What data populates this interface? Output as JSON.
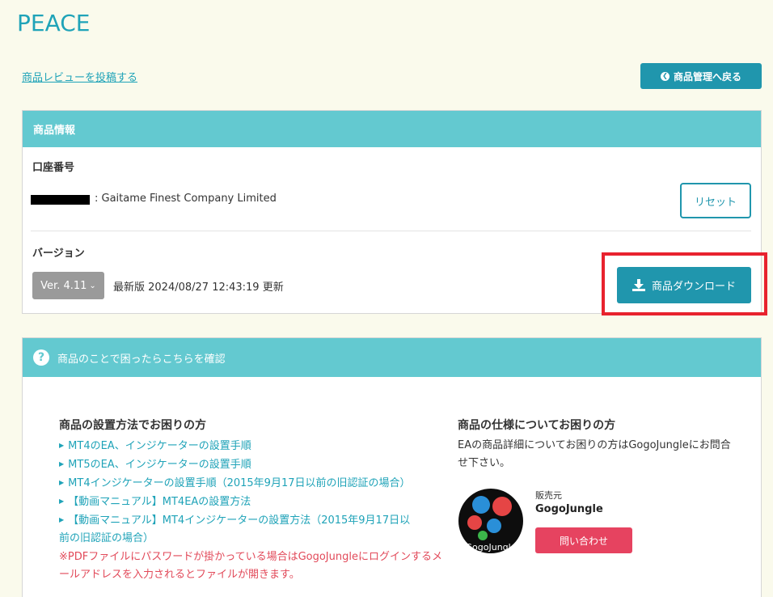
{
  "page": {
    "title": "PEACE",
    "review_link": "商品レビューを投稿する",
    "back_button": "商品管理へ戻る"
  },
  "product_info": {
    "header": "商品情報",
    "account_label": "口座番号",
    "account_value": ": Gaitame Finest Company Limited",
    "reset_button": "リセット",
    "version_label": "バージョン",
    "version_selected": "Ver. 4.11",
    "version_status": "最新版 2024/08/27 12:43:19 更新",
    "download_button": "商品ダウンロード"
  },
  "help": {
    "header": "商品のことで困ったらこちらを確認",
    "install_title": "商品の設置方法でお困りの方",
    "links": [
      "MT4のEA、インジケーターの設置手順",
      "MT5のEA、インジケーターの設置手順",
      "MT4インジケーターの設置手順（2015年9月17日以前の旧認証の場合）",
      "【動画マニュアル】MT4EAの設置方法",
      "【動画マニュアル】MT4インジケーターの設置方法（2015年9月17日以",
      "前の旧認証の場合）"
    ],
    "warning": "※PDFファイルにパスワードが掛かっている場合はGogoJungleにログインするメールアドレスを入力されるとファイルが開きます。",
    "spec_title": "商品の仕様についてお困りの方",
    "spec_text": "EAの商品詳細についてお困りの方はGogoJungleにお問合せ下さい。",
    "seller_label": "販売元",
    "seller_name": "GogoJungle",
    "seller_logo_text": "GogoJungle",
    "contact_button": "問い合わせ"
  },
  "colors": {
    "accent": "#2096ad",
    "header_bg": "#63c9d0",
    "highlight": "#e8222e",
    "warning": "#e24a5a",
    "contact": "#e64360",
    "background": "#fafaec"
  }
}
